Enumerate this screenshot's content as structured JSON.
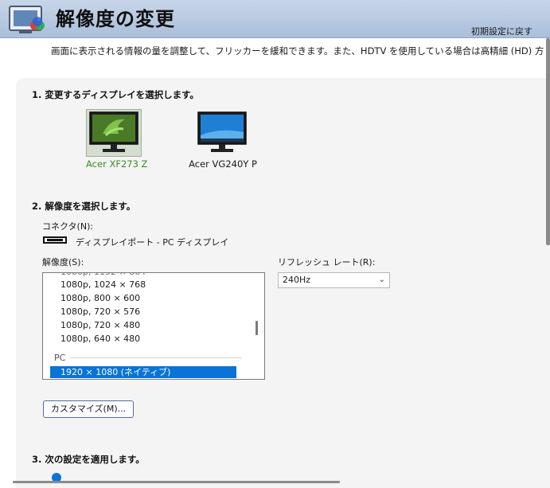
{
  "header": {
    "title": "解像度の変更",
    "restore_label": "初期設定に戻す"
  },
  "description": "画面に表示される情報の量を調整して、フリッカーを緩和できます。また、HDTV を使用している場合は高精細 (HD) 方式を選択し、",
  "step1": {
    "title": "1. 変更するディスプレイを選択します。",
    "displays": [
      {
        "name": "Acer XF273 Z",
        "selected": true
      },
      {
        "name": "Acer VG240Y P",
        "selected": false
      }
    ]
  },
  "step2": {
    "title": "2. 解像度を選択します。",
    "connector_label": "コネクタ(N):",
    "connector_value": "ディスプレイポート - PC ディスプレイ",
    "resolution_label": "解像度(S):",
    "resolutions": [
      "1080p, 1024 × 768",
      "1080p, 800 × 600",
      "1080p, 720 × 576",
      "1080p, 720 × 480",
      "1080p, 640 × 480"
    ],
    "group_label": "PC",
    "selected_resolution": "1920 × 1080 (ネイティブ)",
    "refresh_label": "リフレッシュ レート(R):",
    "refresh_value": "240Hz",
    "customize_label": "カスタマイズ(M)..."
  },
  "step3": {
    "title": "3. 次の設定を適用します。"
  },
  "colors": {
    "header_bg": "#b4c6df",
    "accent_blue": "#0a74d6",
    "selected_green": "#3a8d1e"
  }
}
